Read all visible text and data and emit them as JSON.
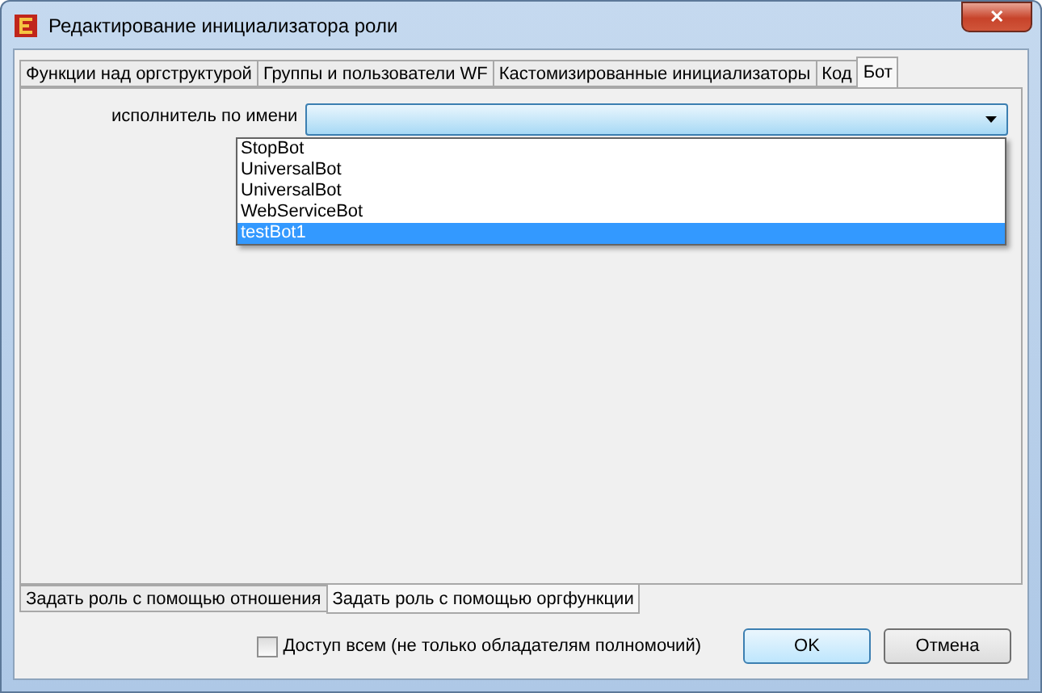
{
  "window": {
    "title": "Редактирование инициализатора роли",
    "close": "✕"
  },
  "tabs": [
    {
      "label": "Функции над оргструктурой",
      "selected": false
    },
    {
      "label": "Группы и пользователи WF",
      "selected": false
    },
    {
      "label": "Кастомизированные инициализаторы",
      "selected": false
    },
    {
      "label": "Код",
      "selected": false
    },
    {
      "label": "Бот",
      "selected": true
    }
  ],
  "field": {
    "label": "исполнитель по имени",
    "expanded": true,
    "options": [
      {
        "label": "StopBot",
        "selected": false
      },
      {
        "label": "UniversalBot",
        "selected": false
      },
      {
        "label": "UniversalBot",
        "selected": false
      },
      {
        "label": "WebServiceBot",
        "selected": false
      },
      {
        "label": "testBot1",
        "selected": true
      }
    ]
  },
  "bottom_tabs": [
    {
      "label": "Задать роль с помощью отношения",
      "selected": false
    },
    {
      "label": "Задать роль с помощью оргфункции",
      "selected": true
    }
  ],
  "access_checkbox": {
    "label": "Доступ всем (не только обладателям полномочий)",
    "checked": false
  },
  "buttons": [
    {
      "label": "OK",
      "kind": "default"
    },
    {
      "label": "Отмена",
      "kind": "normal"
    }
  ]
}
